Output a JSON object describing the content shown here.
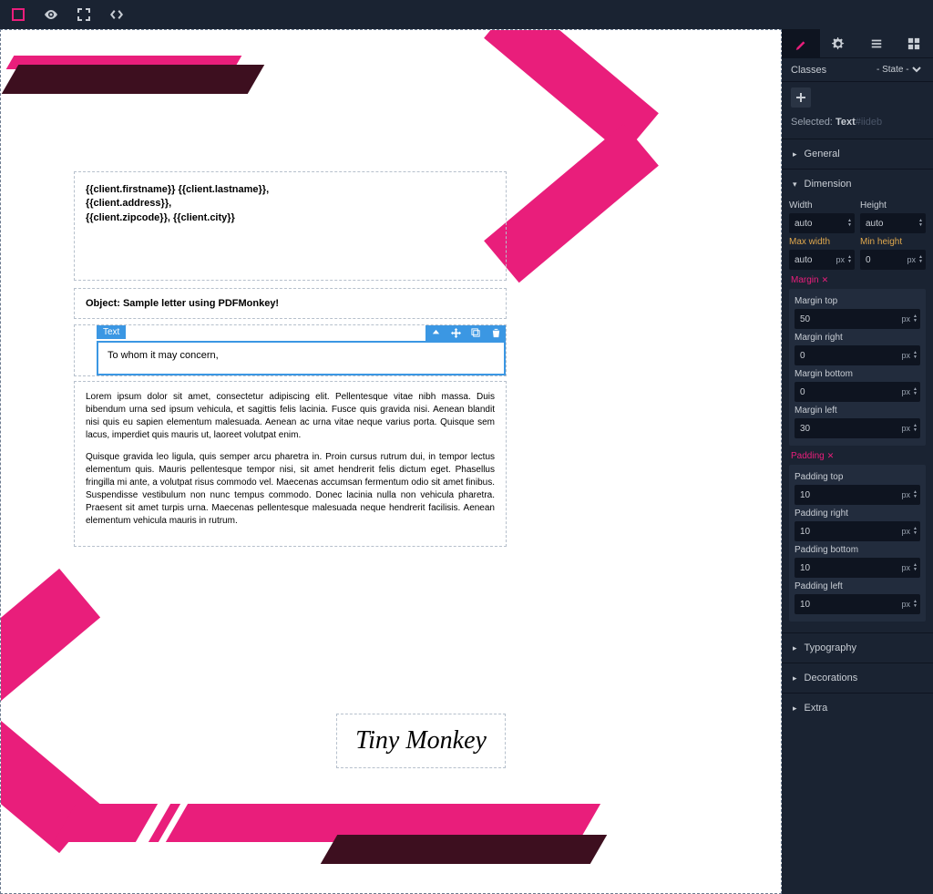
{
  "toolbar": {
    "icons": [
      "rect",
      "eye",
      "expand",
      "code"
    ]
  },
  "canvas": {
    "address": {
      "line1": "{{client.firstname}} {{client.lastname}},",
      "line2": "{{client.address}},",
      "line3": "{{client.zipcode}}, {{client.city}}"
    },
    "object_label": "Object: Sample letter using PDFMonkey!",
    "selected_badge": "Text",
    "greeting": "To whom it may concern,",
    "para1": "Lorem ipsum dolor sit amet, consectetur adipiscing elit. Pellentesque vitae nibh massa. Duis bibendum urna sed ipsum vehicula, et sagittis felis lacinia. Fusce quis gravida nisi. Aenean blandit nisi quis eu sapien elementum malesuada. Aenean ac urna vitae neque varius porta. Quisque sem lacus, imperdiet quis mauris ut, laoreet volutpat enim.",
    "para2": "Quisque gravida leo ligula, quis semper arcu pharetra in. Proin cursus rutrum dui, in tempor lectus elementum quis. Mauris pellentesque tempor nisi, sit amet hendrerit felis dictum eget. Phasellus fringilla mi ante, a volutpat risus commodo vel. Maecenas accumsan fermentum odio sit amet finibus. Suspendisse vestibulum non nunc tempus commodo. Donec lacinia nulla non vehicula pharetra. Praesent sit amet turpis urna. Maecenas pellentesque malesuada neque hendrerit facilisis. Aenean elementum vehicula mauris in rutrum.",
    "signature": "Tiny Monkey"
  },
  "panel": {
    "tabs": [
      "brush",
      "gear",
      "list",
      "grid"
    ],
    "classes_label": "Classes",
    "state_label": "- State -",
    "selected_label": "Selected:",
    "selected_type": "Text",
    "selected_hash": "#iideb",
    "sections": {
      "general": "General",
      "dimension": "Dimension",
      "typography": "Typography",
      "decorations": "Decorations",
      "extra": "Extra"
    },
    "dimension": {
      "width_label": "Width",
      "width_value": "auto",
      "height_label": "Height",
      "height_value": "auto",
      "maxwidth_label": "Max width",
      "maxwidth_value": "auto",
      "maxwidth_unit": "px",
      "minheight_label": "Min height",
      "minheight_value": "0",
      "minheight_unit": "px",
      "margin_label": "Margin",
      "margin": {
        "top_label": "Margin top",
        "top": "50",
        "top_unit": "px",
        "right_label": "Margin right",
        "right": "0",
        "right_unit": "px",
        "bottom_label": "Margin bottom",
        "bottom": "0",
        "bottom_unit": "px",
        "left_label": "Margin left",
        "left": "30",
        "left_unit": "px"
      },
      "padding_label": "Padding",
      "padding": {
        "top_label": "Padding top",
        "top": "10",
        "top_unit": "px",
        "right_label": "Padding right",
        "right": "10",
        "right_unit": "px",
        "bottom_label": "Padding bottom",
        "bottom": "10",
        "bottom_unit": "px",
        "left_label": "Padding left",
        "left": "10",
        "left_unit": "px"
      }
    }
  }
}
